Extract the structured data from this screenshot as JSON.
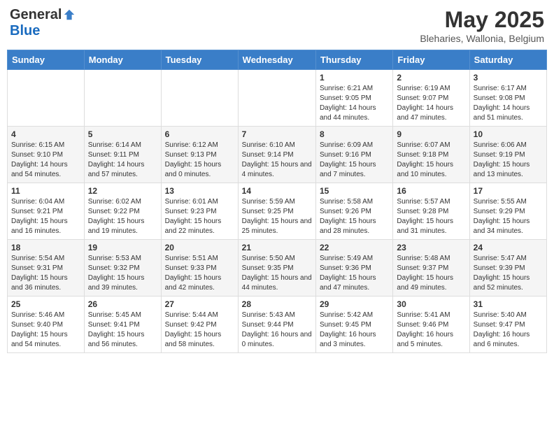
{
  "header": {
    "logo_general": "General",
    "logo_blue": "Blue",
    "month": "May 2025",
    "location": "Bleharies, Wallonia, Belgium"
  },
  "days_of_week": [
    "Sunday",
    "Monday",
    "Tuesday",
    "Wednesday",
    "Thursday",
    "Friday",
    "Saturday"
  ],
  "weeks": [
    [
      {
        "day": "",
        "info": ""
      },
      {
        "day": "",
        "info": ""
      },
      {
        "day": "",
        "info": ""
      },
      {
        "day": "",
        "info": ""
      },
      {
        "day": "1",
        "info": "Sunrise: 6:21 AM\nSunset: 9:05 PM\nDaylight: 14 hours\nand 44 minutes."
      },
      {
        "day": "2",
        "info": "Sunrise: 6:19 AM\nSunset: 9:07 PM\nDaylight: 14 hours\nand 47 minutes."
      },
      {
        "day": "3",
        "info": "Sunrise: 6:17 AM\nSunset: 9:08 PM\nDaylight: 14 hours\nand 51 minutes."
      }
    ],
    [
      {
        "day": "4",
        "info": "Sunrise: 6:15 AM\nSunset: 9:10 PM\nDaylight: 14 hours\nand 54 minutes."
      },
      {
        "day": "5",
        "info": "Sunrise: 6:14 AM\nSunset: 9:11 PM\nDaylight: 14 hours\nand 57 minutes."
      },
      {
        "day": "6",
        "info": "Sunrise: 6:12 AM\nSunset: 9:13 PM\nDaylight: 15 hours\nand 0 minutes."
      },
      {
        "day": "7",
        "info": "Sunrise: 6:10 AM\nSunset: 9:14 PM\nDaylight: 15 hours\nand 4 minutes."
      },
      {
        "day": "8",
        "info": "Sunrise: 6:09 AM\nSunset: 9:16 PM\nDaylight: 15 hours\nand 7 minutes."
      },
      {
        "day": "9",
        "info": "Sunrise: 6:07 AM\nSunset: 9:18 PM\nDaylight: 15 hours\nand 10 minutes."
      },
      {
        "day": "10",
        "info": "Sunrise: 6:06 AM\nSunset: 9:19 PM\nDaylight: 15 hours\nand 13 minutes."
      }
    ],
    [
      {
        "day": "11",
        "info": "Sunrise: 6:04 AM\nSunset: 9:21 PM\nDaylight: 15 hours\nand 16 minutes."
      },
      {
        "day": "12",
        "info": "Sunrise: 6:02 AM\nSunset: 9:22 PM\nDaylight: 15 hours\nand 19 minutes."
      },
      {
        "day": "13",
        "info": "Sunrise: 6:01 AM\nSunset: 9:23 PM\nDaylight: 15 hours\nand 22 minutes."
      },
      {
        "day": "14",
        "info": "Sunrise: 5:59 AM\nSunset: 9:25 PM\nDaylight: 15 hours\nand 25 minutes."
      },
      {
        "day": "15",
        "info": "Sunrise: 5:58 AM\nSunset: 9:26 PM\nDaylight: 15 hours\nand 28 minutes."
      },
      {
        "day": "16",
        "info": "Sunrise: 5:57 AM\nSunset: 9:28 PM\nDaylight: 15 hours\nand 31 minutes."
      },
      {
        "day": "17",
        "info": "Sunrise: 5:55 AM\nSunset: 9:29 PM\nDaylight: 15 hours\nand 34 minutes."
      }
    ],
    [
      {
        "day": "18",
        "info": "Sunrise: 5:54 AM\nSunset: 9:31 PM\nDaylight: 15 hours\nand 36 minutes."
      },
      {
        "day": "19",
        "info": "Sunrise: 5:53 AM\nSunset: 9:32 PM\nDaylight: 15 hours\nand 39 minutes."
      },
      {
        "day": "20",
        "info": "Sunrise: 5:51 AM\nSunset: 9:33 PM\nDaylight: 15 hours\nand 42 minutes."
      },
      {
        "day": "21",
        "info": "Sunrise: 5:50 AM\nSunset: 9:35 PM\nDaylight: 15 hours\nand 44 minutes."
      },
      {
        "day": "22",
        "info": "Sunrise: 5:49 AM\nSunset: 9:36 PM\nDaylight: 15 hours\nand 47 minutes."
      },
      {
        "day": "23",
        "info": "Sunrise: 5:48 AM\nSunset: 9:37 PM\nDaylight: 15 hours\nand 49 minutes."
      },
      {
        "day": "24",
        "info": "Sunrise: 5:47 AM\nSunset: 9:39 PM\nDaylight: 15 hours\nand 52 minutes."
      }
    ],
    [
      {
        "day": "25",
        "info": "Sunrise: 5:46 AM\nSunset: 9:40 PM\nDaylight: 15 hours\nand 54 minutes."
      },
      {
        "day": "26",
        "info": "Sunrise: 5:45 AM\nSunset: 9:41 PM\nDaylight: 15 hours\nand 56 minutes."
      },
      {
        "day": "27",
        "info": "Sunrise: 5:44 AM\nSunset: 9:42 PM\nDaylight: 15 hours\nand 58 minutes."
      },
      {
        "day": "28",
        "info": "Sunrise: 5:43 AM\nSunset: 9:44 PM\nDaylight: 16 hours\nand 0 minutes."
      },
      {
        "day": "29",
        "info": "Sunrise: 5:42 AM\nSunset: 9:45 PM\nDaylight: 16 hours\nand 3 minutes."
      },
      {
        "day": "30",
        "info": "Sunrise: 5:41 AM\nSunset: 9:46 PM\nDaylight: 16 hours\nand 5 minutes."
      },
      {
        "day": "31",
        "info": "Sunrise: 5:40 AM\nSunset: 9:47 PM\nDaylight: 16 hours\nand 6 minutes."
      }
    ]
  ]
}
